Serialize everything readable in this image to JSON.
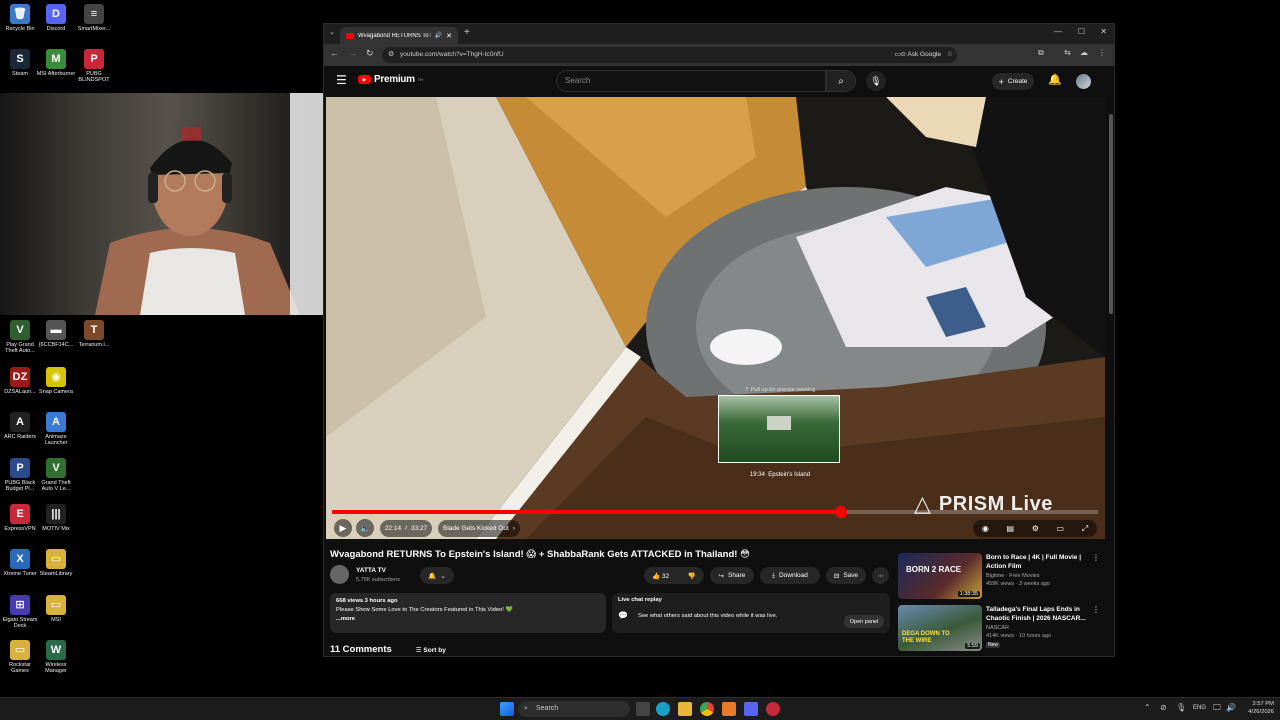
{
  "desktop": {
    "icons": [
      {
        "label": "Recycle Bin",
        "glyph": "🗑",
        "color": "#3a78c9"
      },
      {
        "label": "Discord",
        "glyph": "D",
        "color": "#5865f2"
      },
      {
        "label": "SmartMixer...",
        "glyph": "≡",
        "color": "#444"
      },
      {
        "label": "Steam",
        "glyph": "S",
        "color": "#1b2838"
      },
      {
        "label": "MSI Afterburner",
        "glyph": "M",
        "color": "#3a8c3a"
      },
      {
        "label": "PUBG BLINDSPOT",
        "glyph": "P",
        "color": "#c8283a"
      },
      {
        "label": "Play Grand Theft Auto...",
        "glyph": "V",
        "color": "#2f5f2f"
      },
      {
        "label": "{6CCBF14C...",
        "glyph": "▬",
        "color": "#555"
      },
      {
        "label": "Terrarium.l...",
        "glyph": "T",
        "color": "#7a4a2a"
      },
      {
        "label": "DZSALaun...",
        "glyph": "DZ",
        "color": "#9a1a1a"
      },
      {
        "label": "Snap Camera",
        "glyph": "◉",
        "color": "#d6c400"
      },
      {
        "label": "ARC Raiders",
        "glyph": "A",
        "color": "#222"
      },
      {
        "label": "Animaze Launcher",
        "glyph": "A",
        "color": "#3a7ad6"
      },
      {
        "label": "PUBG Black Budget Pl...",
        "glyph": "P",
        "color": "#2a4a8a"
      },
      {
        "label": "Grand Theft Auto V Le...",
        "glyph": "V",
        "color": "#2f6f2f"
      },
      {
        "label": "ExpressVPN",
        "glyph": "E",
        "color": "#c8283a"
      },
      {
        "label": "MOTIV Mix",
        "glyph": "|||",
        "color": "#222"
      },
      {
        "label": "Xtreme Tuner",
        "glyph": "X",
        "color": "#2a6aba"
      },
      {
        "label": "SteamLibrary",
        "glyph": "▭",
        "color": "#d8b23a"
      },
      {
        "label": "Elgato Stream Deck",
        "glyph": "⊞",
        "color": "#4a3ab0"
      },
      {
        "label": "MSI",
        "glyph": "▭",
        "color": "#d8b23a"
      },
      {
        "label": "Rockstar Games",
        "glyph": "▭",
        "color": "#d8b23a"
      },
      {
        "label": "Wireless Manager",
        "glyph": "W",
        "color": "#2a6a4a"
      }
    ]
  },
  "browser": {
    "tab_title": "Wvagabond RETURNS To E...",
    "url": "youtube.com/watch?v=ThgH-tc0nfU",
    "ask_google": "Ask Google"
  },
  "youtube": {
    "logo": "Premium",
    "logo_sup": "TH",
    "search_placeholder": "Search",
    "create_label": "Create",
    "player": {
      "time_current": "22:14",
      "time_total": "33:27",
      "chapter": "Blade Gets Kicked Out",
      "progress": 0.665,
      "hover_position": 0.62,
      "preview_hint": "Pull up for precise seeking",
      "preview_time": "19:34",
      "preview_chapter": "Epstein's Island",
      "watermark": "PRISM Live"
    },
    "video_title": "Wvagabond RETURNS To Epstein's Island! 😱 + ShabbaRank Gets ATTACKED in Thailand! 😳",
    "channel": {
      "name": "YATTA TV",
      "subscribers": "5.75K subscribers"
    },
    "actions": {
      "likes": "32",
      "share": "Share",
      "download": "Download",
      "save": "Save"
    },
    "description": {
      "meta": "668 views  3 hours ago",
      "text": "Please Show Some Love to The Creators Featured in This Video! 💚",
      "more": "...more"
    },
    "live_chat": {
      "title": "Live chat replay",
      "text": "See what others said about this video while it was live.",
      "button": "Open panel"
    },
    "comments": {
      "count": "11 Comments",
      "sort": "Sort by"
    },
    "related": [
      {
        "title": "Born to Race | 4K | Full Movie | Action Film",
        "channel": "Bigtime · Free Movies",
        "meta": "459K views · 3 weeks ago",
        "duration": "1:38:35",
        "thumb_text": "BORN 2 RACE",
        "badge": ""
      },
      {
        "title": "Talladega's Final Laps Ends in Chaotic Finish | 2026 NASCAR...",
        "channel": "NASCAR",
        "meta": "414K views · 10 hours ago",
        "duration": "5:59",
        "thumb_text": "DEGA DOWN TO THE WIRE",
        "badge": "New"
      }
    ]
  },
  "taskbar": {
    "search": "Search",
    "language": "ENG",
    "time": "3:57 PM",
    "date": "4/26/2026"
  }
}
